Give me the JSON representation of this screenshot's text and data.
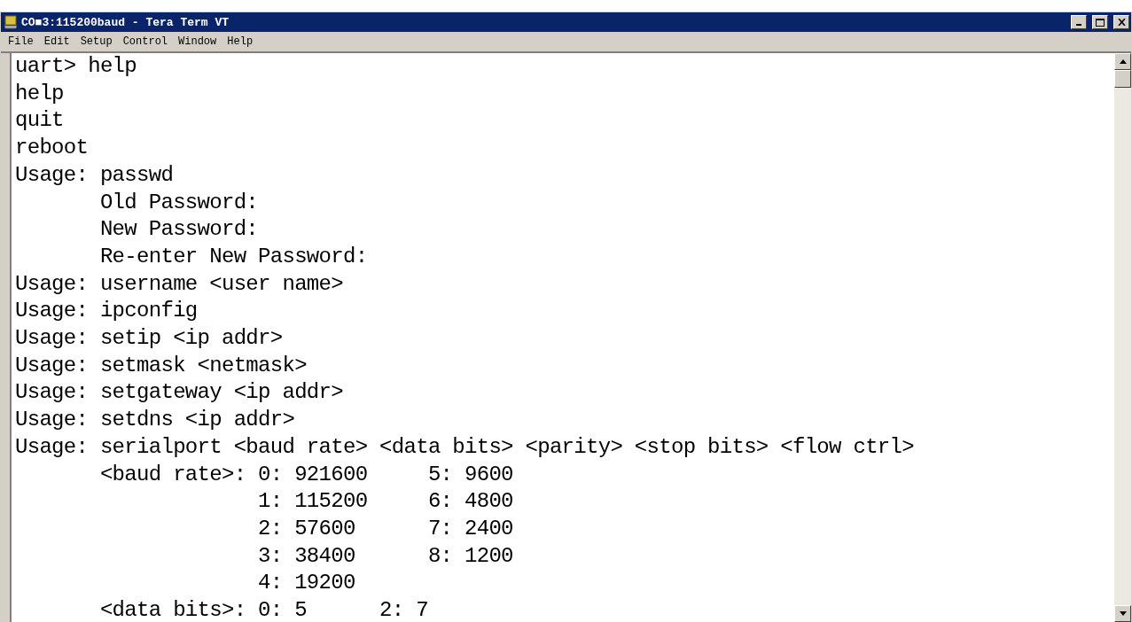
{
  "window": {
    "title": "CO■3:115200baud - Tera Term VT"
  },
  "menu": [
    {
      "label": "File"
    },
    {
      "label": "Edit"
    },
    {
      "label": "Setup"
    },
    {
      "label": "Control"
    },
    {
      "label": "Window"
    },
    {
      "label": "Help"
    }
  ],
  "terminal": {
    "lines": [
      "uart> help",
      "help",
      "quit",
      "reboot",
      "Usage: passwd",
      "       Old Password:",
      "       New Password:",
      "       Re-enter New Password:",
      "Usage: username <user name>",
      "Usage: ipconfig",
      "Usage: setip <ip addr>",
      "Usage: setmask <netmask>",
      "Usage: setgateway <ip addr>",
      "Usage: setdns <ip addr>",
      "Usage: serialport <baud rate> <data bits> <parity> <stop bits> <flow ctrl>",
      "       <baud rate>: 0: 921600     5: 9600",
      "                    1: 115200     6: 4800",
      "                    2: 57600      7: 2400",
      "                    3: 38400      8: 1200",
      "                    4: 19200",
      "       <data bits>: 0: 5      2: 7"
    ]
  }
}
